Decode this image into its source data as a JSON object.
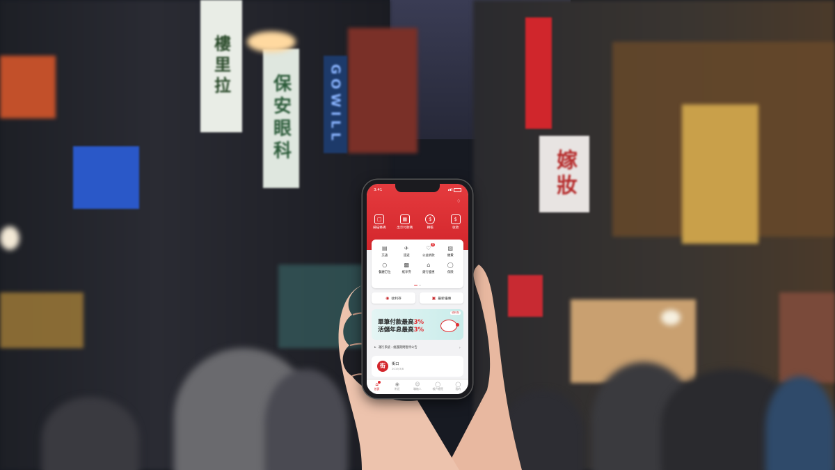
{
  "status_bar": {
    "time": "3:41"
  },
  "quick_actions": [
    {
      "icon": "scan-icon",
      "label": "掃描條碼"
    },
    {
      "icon": "qr-code-icon",
      "label": "出示付款碼"
    },
    {
      "icon": "transfer-icon",
      "label": "轉帳"
    },
    {
      "icon": "receive-money-icon",
      "label": "收款"
    }
  ],
  "services": [
    {
      "icon": "bus-icon",
      "label": "交通",
      "badge": ""
    },
    {
      "icon": "plane-icon",
      "label": "旅遊",
      "badge": ""
    },
    {
      "icon": "heart-icon",
      "label": "公益捐款",
      "badge": "熱"
    },
    {
      "icon": "bill-icon",
      "label": "繳費",
      "badge": ""
    },
    {
      "icon": "dining-icon",
      "label": "餐廳訂位",
      "badge": ""
    },
    {
      "icon": "ticket-icon",
      "label": "紙享券",
      "badge": ""
    },
    {
      "icon": "bank-icon",
      "label": "銀行優惠",
      "badge": ""
    },
    {
      "icon": "insurance-icon",
      "label": "保險",
      "badge": ""
    }
  ],
  "pills": [
    {
      "icon": "piggy-bank-icon",
      "label": "收利存"
    },
    {
      "icon": "calendar-icon",
      "label": "最新優惠"
    }
  ],
  "banner": {
    "tag": "收利存",
    "line1_text": "單筆付款最高",
    "line1_pct": "3%",
    "line2_text": "活儲年息最高",
    "line2_pct": "3%"
  },
  "notice": {
    "text": "運行系統・維護期間暫停公告"
  },
  "store": {
    "logo_char": "街",
    "name": "街口",
    "date": "2019/3/8"
  },
  "tab_bar": [
    {
      "icon": "home-icon",
      "label": "首頁",
      "active": true
    },
    {
      "icon": "location-icon",
      "label": "附近",
      "active": false
    },
    {
      "icon": "people-icon",
      "label": "聯絡人",
      "active": false
    },
    {
      "icon": "wallet-icon",
      "label": "帳戶總覽",
      "active": false
    },
    {
      "icon": "profile-icon",
      "label": "我的",
      "active": false
    }
  ],
  "colors": {
    "brand_red": "#d3262c",
    "accent_red": "#e02c30",
    "banner_teal": "#c9ecea"
  }
}
